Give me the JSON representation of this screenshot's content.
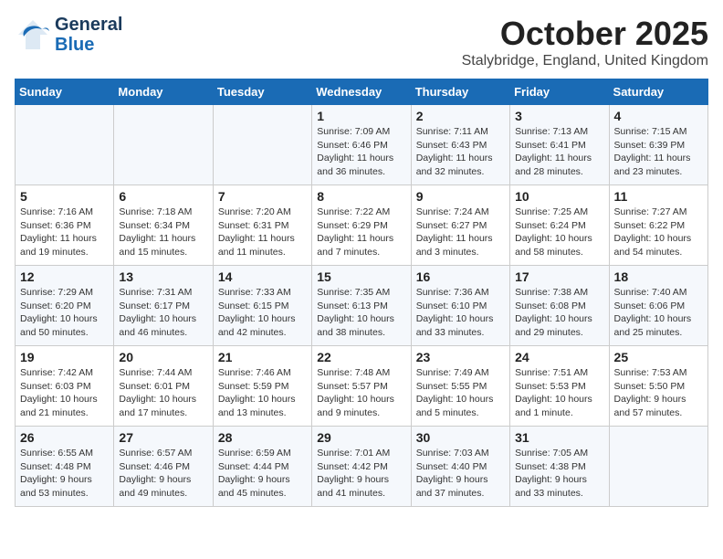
{
  "header": {
    "logo_general": "General",
    "logo_blue": "Blue",
    "month_title": "October 2025",
    "location": "Stalybridge, England, United Kingdom"
  },
  "days_of_week": [
    "Sunday",
    "Monday",
    "Tuesday",
    "Wednesday",
    "Thursday",
    "Friday",
    "Saturday"
  ],
  "weeks": [
    [
      {
        "day": "",
        "info": ""
      },
      {
        "day": "",
        "info": ""
      },
      {
        "day": "",
        "info": ""
      },
      {
        "day": "1",
        "info": "Sunrise: 7:09 AM\nSunset: 6:46 PM\nDaylight: 11 hours\nand 36 minutes."
      },
      {
        "day": "2",
        "info": "Sunrise: 7:11 AM\nSunset: 6:43 PM\nDaylight: 11 hours\nand 32 minutes."
      },
      {
        "day": "3",
        "info": "Sunrise: 7:13 AM\nSunset: 6:41 PM\nDaylight: 11 hours\nand 28 minutes."
      },
      {
        "day": "4",
        "info": "Sunrise: 7:15 AM\nSunset: 6:39 PM\nDaylight: 11 hours\nand 23 minutes."
      }
    ],
    [
      {
        "day": "5",
        "info": "Sunrise: 7:16 AM\nSunset: 6:36 PM\nDaylight: 11 hours\nand 19 minutes."
      },
      {
        "day": "6",
        "info": "Sunrise: 7:18 AM\nSunset: 6:34 PM\nDaylight: 11 hours\nand 15 minutes."
      },
      {
        "day": "7",
        "info": "Sunrise: 7:20 AM\nSunset: 6:31 PM\nDaylight: 11 hours\nand 11 minutes."
      },
      {
        "day": "8",
        "info": "Sunrise: 7:22 AM\nSunset: 6:29 PM\nDaylight: 11 hours\nand 7 minutes."
      },
      {
        "day": "9",
        "info": "Sunrise: 7:24 AM\nSunset: 6:27 PM\nDaylight: 11 hours\nand 3 minutes."
      },
      {
        "day": "10",
        "info": "Sunrise: 7:25 AM\nSunset: 6:24 PM\nDaylight: 10 hours\nand 58 minutes."
      },
      {
        "day": "11",
        "info": "Sunrise: 7:27 AM\nSunset: 6:22 PM\nDaylight: 10 hours\nand 54 minutes."
      }
    ],
    [
      {
        "day": "12",
        "info": "Sunrise: 7:29 AM\nSunset: 6:20 PM\nDaylight: 10 hours\nand 50 minutes."
      },
      {
        "day": "13",
        "info": "Sunrise: 7:31 AM\nSunset: 6:17 PM\nDaylight: 10 hours\nand 46 minutes."
      },
      {
        "day": "14",
        "info": "Sunrise: 7:33 AM\nSunset: 6:15 PM\nDaylight: 10 hours\nand 42 minutes."
      },
      {
        "day": "15",
        "info": "Sunrise: 7:35 AM\nSunset: 6:13 PM\nDaylight: 10 hours\nand 38 minutes."
      },
      {
        "day": "16",
        "info": "Sunrise: 7:36 AM\nSunset: 6:10 PM\nDaylight: 10 hours\nand 33 minutes."
      },
      {
        "day": "17",
        "info": "Sunrise: 7:38 AM\nSunset: 6:08 PM\nDaylight: 10 hours\nand 29 minutes."
      },
      {
        "day": "18",
        "info": "Sunrise: 7:40 AM\nSunset: 6:06 PM\nDaylight: 10 hours\nand 25 minutes."
      }
    ],
    [
      {
        "day": "19",
        "info": "Sunrise: 7:42 AM\nSunset: 6:03 PM\nDaylight: 10 hours\nand 21 minutes."
      },
      {
        "day": "20",
        "info": "Sunrise: 7:44 AM\nSunset: 6:01 PM\nDaylight: 10 hours\nand 17 minutes."
      },
      {
        "day": "21",
        "info": "Sunrise: 7:46 AM\nSunset: 5:59 PM\nDaylight: 10 hours\nand 13 minutes."
      },
      {
        "day": "22",
        "info": "Sunrise: 7:48 AM\nSunset: 5:57 PM\nDaylight: 10 hours\nand 9 minutes."
      },
      {
        "day": "23",
        "info": "Sunrise: 7:49 AM\nSunset: 5:55 PM\nDaylight: 10 hours\nand 5 minutes."
      },
      {
        "day": "24",
        "info": "Sunrise: 7:51 AM\nSunset: 5:53 PM\nDaylight: 10 hours\nand 1 minute."
      },
      {
        "day": "25",
        "info": "Sunrise: 7:53 AM\nSunset: 5:50 PM\nDaylight: 9 hours\nand 57 minutes."
      }
    ],
    [
      {
        "day": "26",
        "info": "Sunrise: 6:55 AM\nSunset: 4:48 PM\nDaylight: 9 hours\nand 53 minutes."
      },
      {
        "day": "27",
        "info": "Sunrise: 6:57 AM\nSunset: 4:46 PM\nDaylight: 9 hours\nand 49 minutes."
      },
      {
        "day": "28",
        "info": "Sunrise: 6:59 AM\nSunset: 4:44 PM\nDaylight: 9 hours\nand 45 minutes."
      },
      {
        "day": "29",
        "info": "Sunrise: 7:01 AM\nSunset: 4:42 PM\nDaylight: 9 hours\nand 41 minutes."
      },
      {
        "day": "30",
        "info": "Sunrise: 7:03 AM\nSunset: 4:40 PM\nDaylight: 9 hours\nand 37 minutes."
      },
      {
        "day": "31",
        "info": "Sunrise: 7:05 AM\nSunset: 4:38 PM\nDaylight: 9 hours\nand 33 minutes."
      },
      {
        "day": "",
        "info": ""
      }
    ]
  ]
}
